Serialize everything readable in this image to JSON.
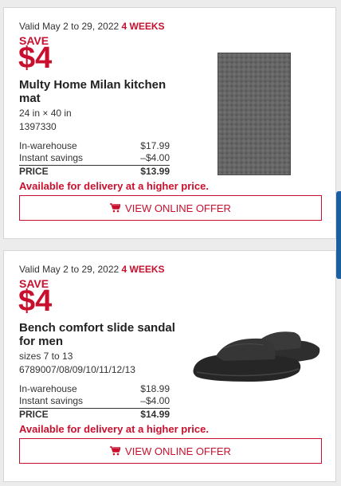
{
  "colors": {
    "accent": "#c8102e",
    "side_tab": "#1c5fa0"
  },
  "offers": [
    {
      "valid_text": "Valid May 2 to 29, 2022",
      "weeks_text": "4 WEEKS",
      "save_label": "SAVE",
      "save_amount": "$4",
      "title": "Multy Home Milan kitchen mat",
      "size": "24 in × 40 in",
      "sku": "1397330",
      "prices": [
        {
          "label": "In-warehouse",
          "value": "$17.99"
        },
        {
          "label": "Instant savings",
          "value": "–$4.00"
        },
        {
          "label": "PRICE",
          "value": "$13.99"
        }
      ],
      "delivery_note": "Available for delivery at a higher price.",
      "button_label": "VIEW ONLINE OFFER",
      "image_icon": "kitchen-mat-image"
    },
    {
      "valid_text": "Valid May 2 to 29, 2022",
      "weeks_text": "4 WEEKS",
      "save_label": "SAVE",
      "save_amount": "$4",
      "title": "Bench comfort slide sandal for men",
      "size": "sizes 7 to 13",
      "sku": "6789007/08/09/10/11/12/13",
      "prices": [
        {
          "label": "In-warehouse",
          "value": "$18.99"
        },
        {
          "label": "Instant savings",
          "value": "–$4.00"
        },
        {
          "label": "PRICE",
          "value": "$14.99"
        }
      ],
      "delivery_note": "Available for delivery at a higher price.",
      "button_label": "VIEW ONLINE OFFER",
      "image_icon": "sandal-image"
    }
  ]
}
